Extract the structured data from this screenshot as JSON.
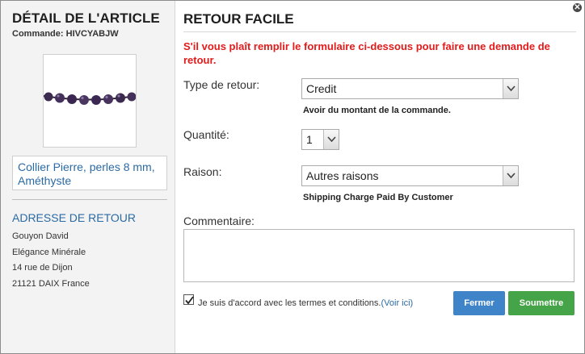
{
  "item_detail": {
    "title": "DÉTAIL DE L'ARTICLE",
    "order_label": "Commande:",
    "order_number": "HIVCYABJW",
    "product_name": "Collier Pierre, perles 8 mm, Améthyste"
  },
  "return_address": {
    "title": "ADRESSE DE RETOUR",
    "lines": [
      "Gouyon David",
      "Elégance Minérale",
      "14 rue de Dijon",
      "21121 DAIX France"
    ]
  },
  "form": {
    "title": "RETOUR FACILE",
    "warning": "S'il vous plaît remplir le formulaire ci-dessous pour faire une demande de retour.",
    "return_type": {
      "label": "Type de retour:",
      "value": "Credit",
      "hint": "Avoir du montant de la commande."
    },
    "quantity": {
      "label": "Quantité:",
      "value": "1"
    },
    "reason": {
      "label": "Raison:",
      "value": "Autres raisons",
      "hint": "Shipping Charge Paid By Customer"
    },
    "comment": {
      "label": "Commentaire:",
      "value": ""
    },
    "terms": {
      "checked": true,
      "text": "Je suis d'accord avec les termes et conditions.",
      "link": "(Voir ici)"
    }
  },
  "buttons": {
    "close": "Fermer",
    "submit": "Soumettre",
    "close_icon": "✕"
  },
  "colors": {
    "link_blue": "#2a6aa5",
    "warning_red": "#e21b1b",
    "close_button": "#3f84c8",
    "submit_button": "#45a348"
  }
}
